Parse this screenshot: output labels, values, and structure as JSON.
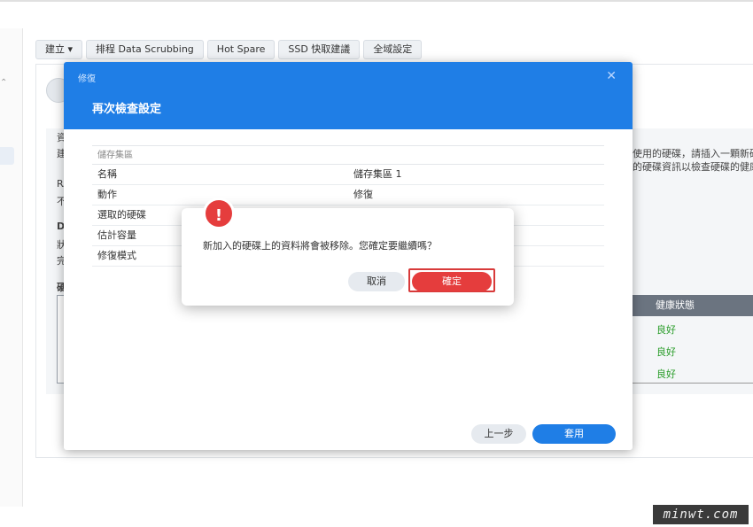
{
  "toolbar": {
    "create_label": "建立",
    "create_caret": "▾",
    "scrub_label": "排程 Data Scrubbing",
    "hotspare_label": "Hot Spare",
    "ssd_label": "SSD 快取建議",
    "global_label": "全域設定"
  },
  "background": {
    "frag_a": "資",
    "frag_b": "建",
    "frag_c": "RA",
    "frag_d": "不",
    "frag_e": "D",
    "frag_f": "狀",
    "frag_g": "完",
    "frag_h": "硬",
    "right_text1": "使用的硬碟，請插入一顆新硬碟",
    "right_text2": "的硬碟資訊以檢查硬碟的健康",
    "table_header": "健康狀態",
    "statuses": [
      "良好",
      "良好",
      "良好"
    ]
  },
  "dialog": {
    "subtitle": "修復",
    "close_glyph": "✕",
    "title": "再次檢查設定",
    "section_label": "儲存集區",
    "rows": [
      {
        "key": "名稱",
        "value": "儲存集區 1"
      },
      {
        "key": "動作",
        "value": "修復"
      },
      {
        "key": "選取的硬碟",
        "value": ""
      },
      {
        "key": "估計容量",
        "value": ""
      },
      {
        "key": "修復模式",
        "value": ""
      }
    ],
    "prev_label": "上一步",
    "apply_label": "套用"
  },
  "confirm": {
    "icon": "!",
    "message": "新加入的硬碟上的資料將會被移除。您確定要繼續嗎？",
    "cancel_label": "取消",
    "ok_label": "確定"
  },
  "watermark": "minwt.com",
  "colors": {
    "accent": "#1f7ee6",
    "danger": "#e53d3d",
    "ok": "#2a9d2a"
  }
}
